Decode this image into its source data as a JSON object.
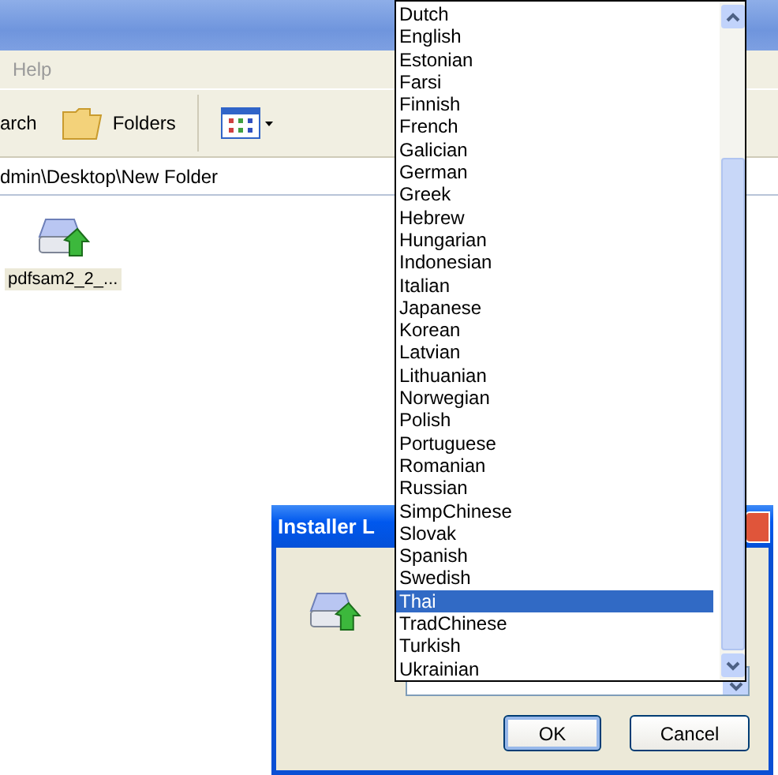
{
  "explorer": {
    "menu": [
      "Help"
    ],
    "toolbar": [
      {
        "kind": "text",
        "label": "arch"
      },
      {
        "kind": "folders",
        "label": "Folders"
      },
      {
        "kind": "views"
      }
    ],
    "address": "dmin\\Desktop\\New Folder",
    "files": [
      {
        "name": "pdfsam2_2_...",
        "selected": true
      }
    ]
  },
  "dialog": {
    "title": "Installer L",
    "buttons": [
      "OK",
      "Cancel"
    ]
  },
  "language_list": {
    "items": [
      {
        "label": "Dutch",
        "selected": false
      },
      {
        "label": "English",
        "selected": false
      },
      {
        "label": "Estonian",
        "selected": false
      },
      {
        "label": "Farsi",
        "selected": false
      },
      {
        "label": "Finnish",
        "selected": false
      },
      {
        "label": "French",
        "selected": false
      },
      {
        "label": "Galician",
        "selected": false
      },
      {
        "label": "German",
        "selected": false
      },
      {
        "label": "Greek",
        "selected": false
      },
      {
        "label": "Hebrew",
        "selected": false
      },
      {
        "label": "Hungarian",
        "selected": false
      },
      {
        "label": "Indonesian",
        "selected": false
      },
      {
        "label": "Italian",
        "selected": false
      },
      {
        "label": "Japanese",
        "selected": false
      },
      {
        "label": "Korean",
        "selected": false
      },
      {
        "label": "Latvian",
        "selected": false
      },
      {
        "label": "Lithuanian",
        "selected": false
      },
      {
        "label": "Norwegian",
        "selected": false
      },
      {
        "label": "Polish",
        "selected": false
      },
      {
        "label": "Portuguese",
        "selected": false
      },
      {
        "label": "Romanian",
        "selected": false
      },
      {
        "label": "Russian",
        "selected": false
      },
      {
        "label": "SimpChinese",
        "selected": false
      },
      {
        "label": "Slovak",
        "selected": false
      },
      {
        "label": "Spanish",
        "selected": false
      },
      {
        "label": "Swedish",
        "selected": false
      },
      {
        "label": "Thai",
        "selected": true
      },
      {
        "label": "TradChinese",
        "selected": false
      },
      {
        "label": "Turkish",
        "selected": false
      },
      {
        "label": "Ukrainian",
        "selected": false
      }
    ]
  }
}
